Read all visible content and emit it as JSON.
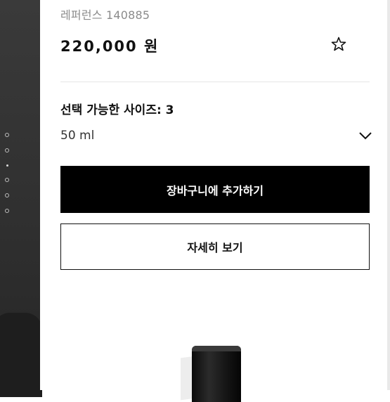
{
  "product": {
    "reference": "레퍼런스 140885",
    "price": "220,000 원",
    "sizes_label": "선택 가능한 사이즈: 3",
    "selected_size": "50 ml"
  },
  "buttons": {
    "add_to_cart": "장바구니에 추가하기",
    "details": "자세히 보기"
  },
  "icons": {
    "favorite": "star-outline-icon",
    "size_dropdown": "chevron-down-icon"
  },
  "gallery": {
    "dot_count": 6,
    "active_index": 2
  },
  "colors": {
    "primary_button_bg": "#000000",
    "primary_button_text": "#ffffff",
    "reference_text": "#8b8b8b"
  }
}
